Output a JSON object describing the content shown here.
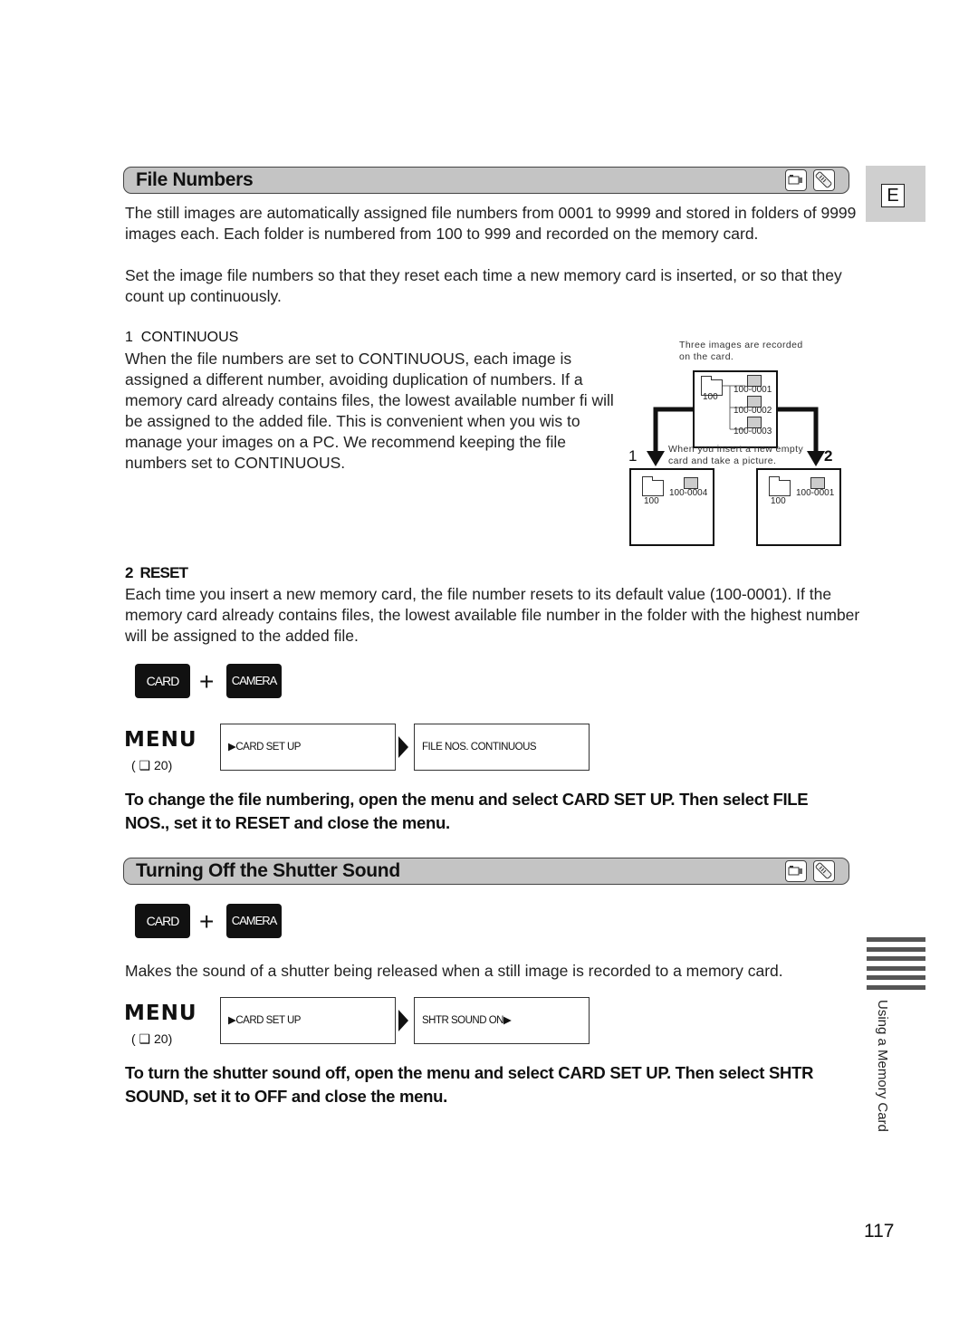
{
  "side_tab": {
    "letter": "E",
    "section_label": "Using a Memory Card"
  },
  "page_number": "117",
  "section1": {
    "title": "File Numbers",
    "icons": [
      "camcorder-icon",
      "remote-control-icon"
    ],
    "intro1": "The still images are automatically assigned file numbers from 0001 to 9999 and stored in folders of 9999 images each. Each folder is numbered from 100 to 999 and recorded on the memory card.",
    "intro2": "Set the image file numbers so that they reset each time a new memory card is inserted, or so that they count up continuously.",
    "item1": {
      "number": "1",
      "heading": "CONTINUOUS",
      "body": "When the file numbers are set to CONTINUOUS, each image is assigned a different number, avoiding duplication of numbers. If a memory card already contains files, the lowest available number fi will be assigned to the added file. This is convenient when you wis to manage your images on a PC. We recommend keeping the file numbers set to CONTINUOUS."
    },
    "diagram": {
      "top_caption": "Three images are recorded on the card.",
      "top_folder": "100",
      "top_files": [
        "100-0001",
        "100-0002",
        "100-0003"
      ],
      "middle_caption": "When you insert a new empty card and take a picture.",
      "left": {
        "label": "1",
        "folder": "100",
        "file": "100-0004"
      },
      "right": {
        "label": "2",
        "folder": "100",
        "file": "100-0001"
      }
    },
    "item2": {
      "number": "2",
      "heading": "RESET",
      "body": "Each time you insert a new memory card, the file number resets to its default value (100-0001). If the memory card already contains files, the lowest available file number in the folder with the highest number will be assigned to the added file."
    },
    "mode": {
      "card": "CARD",
      "plus": "+",
      "camera": "CAMERA"
    },
    "menu": {
      "label": "MENU",
      "ref": "( ❑ 20)",
      "box1": "▶CARD SET UP",
      "box2": "FILE NOS.   CONTINUOUS"
    },
    "instruction": "To change the file numbering, open the menu and select CARD SET UP. Then select FILE NOS., set it to RESET and close the menu."
  },
  "section2": {
    "title": "Turning Off the Shutter Sound",
    "icons": [
      "camcorder-icon",
      "remote-control-icon"
    ],
    "mode": {
      "card": "CARD",
      "plus": "+",
      "camera": "CAMERA"
    },
    "body": "Makes the sound of a shutter being released when a still image is recorded to a memory card.",
    "menu": {
      "label": "MENU",
      "ref": "( ❑ 20)",
      "box1": "▶CARD SET UP",
      "box2": "SHTR SOUND   ON▶"
    },
    "instruction": "To turn the shutter sound off, open the menu and select CARD SET UP. Then select SHTR SOUND, set it to OFF and close the menu."
  }
}
